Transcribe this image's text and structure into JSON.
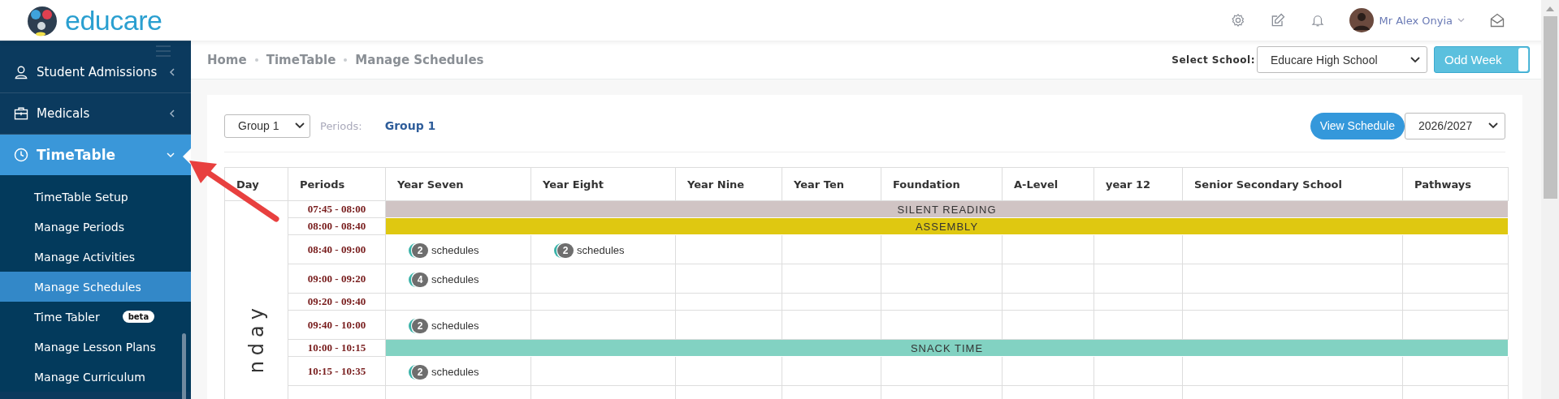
{
  "header": {
    "logo_text": "educare",
    "user_name": "Mr Alex Onyia"
  },
  "sidebar": {
    "items": [
      {
        "label": "Student Admissions",
        "expanded": false,
        "selected": false
      },
      {
        "label": "Medicals",
        "expanded": false,
        "selected": false
      },
      {
        "label": "TimeTable",
        "expanded": true,
        "selected": true,
        "children": [
          {
            "label": "TimeTable Setup",
            "selected": false
          },
          {
            "label": "Manage Periods",
            "selected": false
          },
          {
            "label": "Manage Activities",
            "selected": false
          },
          {
            "label": "Manage Schedules",
            "selected": true
          },
          {
            "label": "Time Tabler",
            "selected": false,
            "badge": "beta"
          },
          {
            "label": "Manage Lesson Plans",
            "selected": false
          },
          {
            "label": "Manage Curriculum",
            "selected": false
          }
        ]
      }
    ]
  },
  "breadcrumb": [
    "Home",
    "TimeTable",
    "Manage Schedules"
  ],
  "school_select": {
    "label": "Select School:",
    "value": "Educare High School"
  },
  "week_toggle": {
    "label": "Odd Week",
    "on": true
  },
  "toolbar": {
    "group_select": "Group 1",
    "periods_label": "Periods:",
    "periods_link": "Group 1",
    "view_button": "View Schedule",
    "year_select": "2026/2027"
  },
  "table": {
    "columns": [
      "Day",
      "Periods",
      "Year Seven",
      "Year Eight",
      "Year Nine",
      "Year Ten",
      "Foundation",
      "A-Level",
      "year 12",
      "Senior Secondary School",
      "Pathways"
    ],
    "day": "nday",
    "rows": [
      {
        "kind": "event",
        "period": "07:45 - 08:00",
        "label": "SILENT READING",
        "color": "#d0c4c4"
      },
      {
        "kind": "event",
        "period": "08:00 - 08:40",
        "label": "ASSEMBLY",
        "color": "#dfc811"
      },
      {
        "kind": "period",
        "period": "08:40 - 09:00",
        "cells": [
          {
            "kind": "schedules",
            "count": "2",
            "label": "schedules"
          },
          {
            "kind": "schedules",
            "count": "2",
            "label": "schedules"
          },
          {
            "kind": "empty"
          },
          {
            "kind": "empty"
          },
          {
            "kind": "empty"
          },
          {
            "kind": "empty"
          },
          {
            "kind": "empty"
          },
          {
            "kind": "empty"
          },
          {
            "kind": "empty"
          }
        ]
      },
      {
        "kind": "period",
        "period": "09:00 - 09:20",
        "cells": [
          {
            "kind": "schedules",
            "count": "4",
            "label": "schedules"
          },
          {
            "kind": "empty"
          },
          {
            "kind": "empty"
          },
          {
            "kind": "empty"
          },
          {
            "kind": "empty"
          },
          {
            "kind": "empty"
          },
          {
            "kind": "empty"
          },
          {
            "kind": "empty"
          },
          {
            "kind": "empty"
          }
        ]
      },
      {
        "kind": "period",
        "period": "09:20 - 09:40",
        "cells": [
          {
            "kind": "empty"
          },
          {
            "kind": "empty"
          },
          {
            "kind": "empty"
          },
          {
            "kind": "empty"
          },
          {
            "kind": "empty"
          },
          {
            "kind": "empty"
          },
          {
            "kind": "empty"
          },
          {
            "kind": "empty"
          },
          {
            "kind": "empty"
          }
        ]
      },
      {
        "kind": "period",
        "period": "09:40 - 10:00",
        "cells": [
          {
            "kind": "schedules",
            "count": "2",
            "label": "schedules"
          },
          {
            "kind": "empty"
          },
          {
            "kind": "empty"
          },
          {
            "kind": "empty"
          },
          {
            "kind": "empty"
          },
          {
            "kind": "empty"
          },
          {
            "kind": "empty"
          },
          {
            "kind": "empty"
          },
          {
            "kind": "empty"
          }
        ]
      },
      {
        "kind": "event",
        "period": "10:00 - 10:15",
        "label": "SNACK TIME",
        "color": "#82d2c2"
      },
      {
        "kind": "period",
        "period": "10:15 - 10:35",
        "cells": [
          {
            "kind": "schedules",
            "count": "2",
            "label": "schedules"
          },
          {
            "kind": "empty"
          },
          {
            "kind": "empty"
          },
          {
            "kind": "empty"
          },
          {
            "kind": "empty"
          },
          {
            "kind": "empty"
          },
          {
            "kind": "empty"
          },
          {
            "kind": "empty"
          },
          {
            "kind": "empty"
          }
        ]
      }
    ]
  }
}
